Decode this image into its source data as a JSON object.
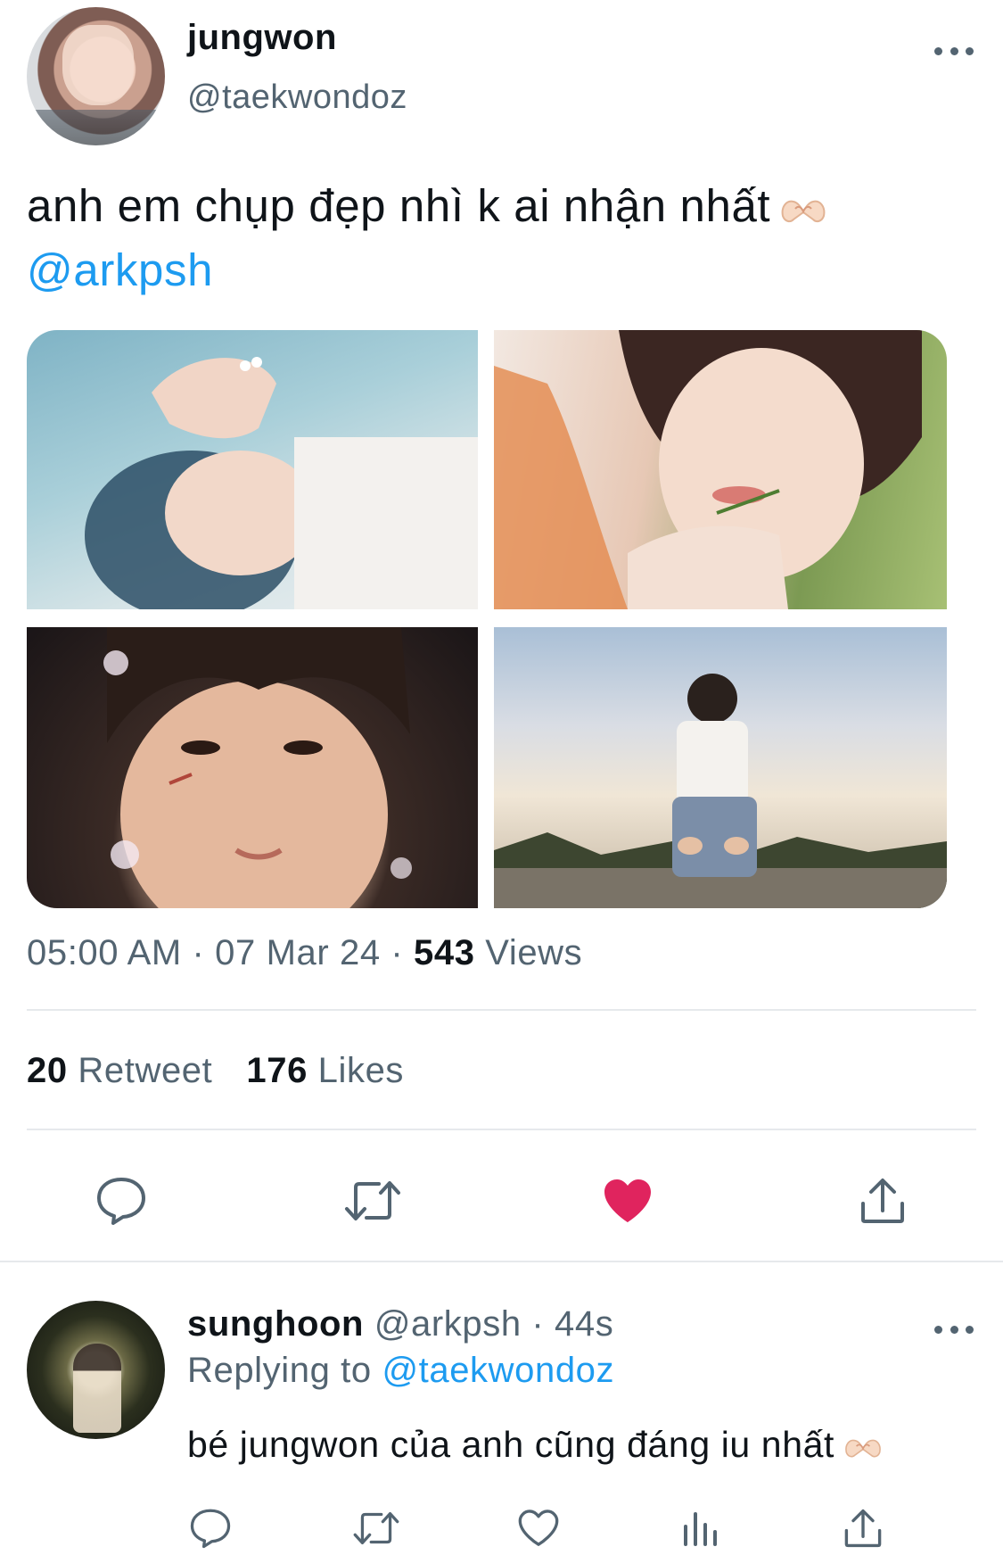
{
  "tweet": {
    "display_name": "jungwon",
    "handle": "@taekwondoz",
    "text": "anh em chụp đẹp nhì k ai nhận nhất",
    "emoji": "🫶",
    "mention": "@arkpsh",
    "time": "05:00 AM",
    "separator": "·",
    "date": "07 Mar 24",
    "views_count": "543",
    "views_label": "Views",
    "retweets_count": "20",
    "retweets_label": "Retweet",
    "likes_count": "176",
    "likes_label": "Likes",
    "liked": true
  },
  "actions": {
    "icons": [
      "reply-icon",
      "retweet-icon",
      "heart-filled-icon",
      "share-icon"
    ],
    "like_color": "#e0245e",
    "icon_color": "#536471"
  },
  "reply": {
    "display_name": "sunghoon",
    "handle": "@arkpsh",
    "separator": "·",
    "time_ago": "44s",
    "replying_label": "Replying to",
    "replying_to": "@taekwondoz",
    "text": "bé jungwon của anh cũng đáng iu nhất",
    "emoji": "🫶",
    "action_icons": [
      "reply-icon",
      "retweet-icon",
      "heart-outline-icon",
      "analytics-icon",
      "share-icon"
    ]
  },
  "colors": {
    "accent": "#1d9bf0",
    "text_primary": "#0f1419",
    "text_secondary": "#536471",
    "divider": "#e6e9ec",
    "like": "#e0245e"
  }
}
